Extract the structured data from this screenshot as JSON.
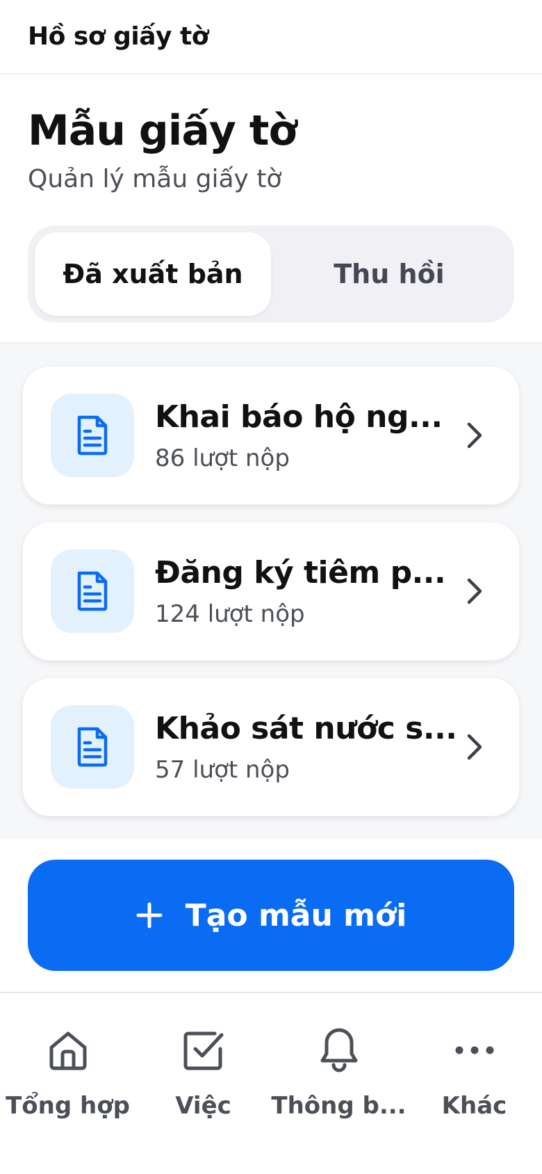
{
  "topbar": {
    "title": "Hồ sơ giấy tờ"
  },
  "header": {
    "title": "Mẫu giấy tờ",
    "subtitle": "Quản lý mẫu giấy tờ",
    "tabs": [
      {
        "label": "Đã xuất bản",
        "active": true
      },
      {
        "label": "Thu hồi",
        "active": false
      }
    ]
  },
  "templates": [
    {
      "title": "Khai báo hộ ng...",
      "submissions": "86 lượt nộp",
      "icon": "document-icon"
    },
    {
      "title": "Đăng ký tiêm p...",
      "submissions": "124 lượt nộp",
      "icon": "document-icon"
    },
    {
      "title": "Khảo sát nước s...",
      "submissions": "57 lượt nộp",
      "icon": "document-icon"
    }
  ],
  "cta": {
    "label": "Tạo mẫu mới",
    "icon": "plus-icon"
  },
  "bottom_nav": [
    {
      "label": "Tổng hợp",
      "icon": "home-icon"
    },
    {
      "label": "Việc",
      "icon": "checkbox-icon"
    },
    {
      "label": "Thông b...",
      "icon": "bell-icon"
    },
    {
      "label": "Khác",
      "icon": "more-icon"
    }
  ],
  "colors": {
    "primary": "#0a6cf2",
    "icon_bg": "#e3f1fd",
    "list_bg": "#f6f7f9"
  }
}
